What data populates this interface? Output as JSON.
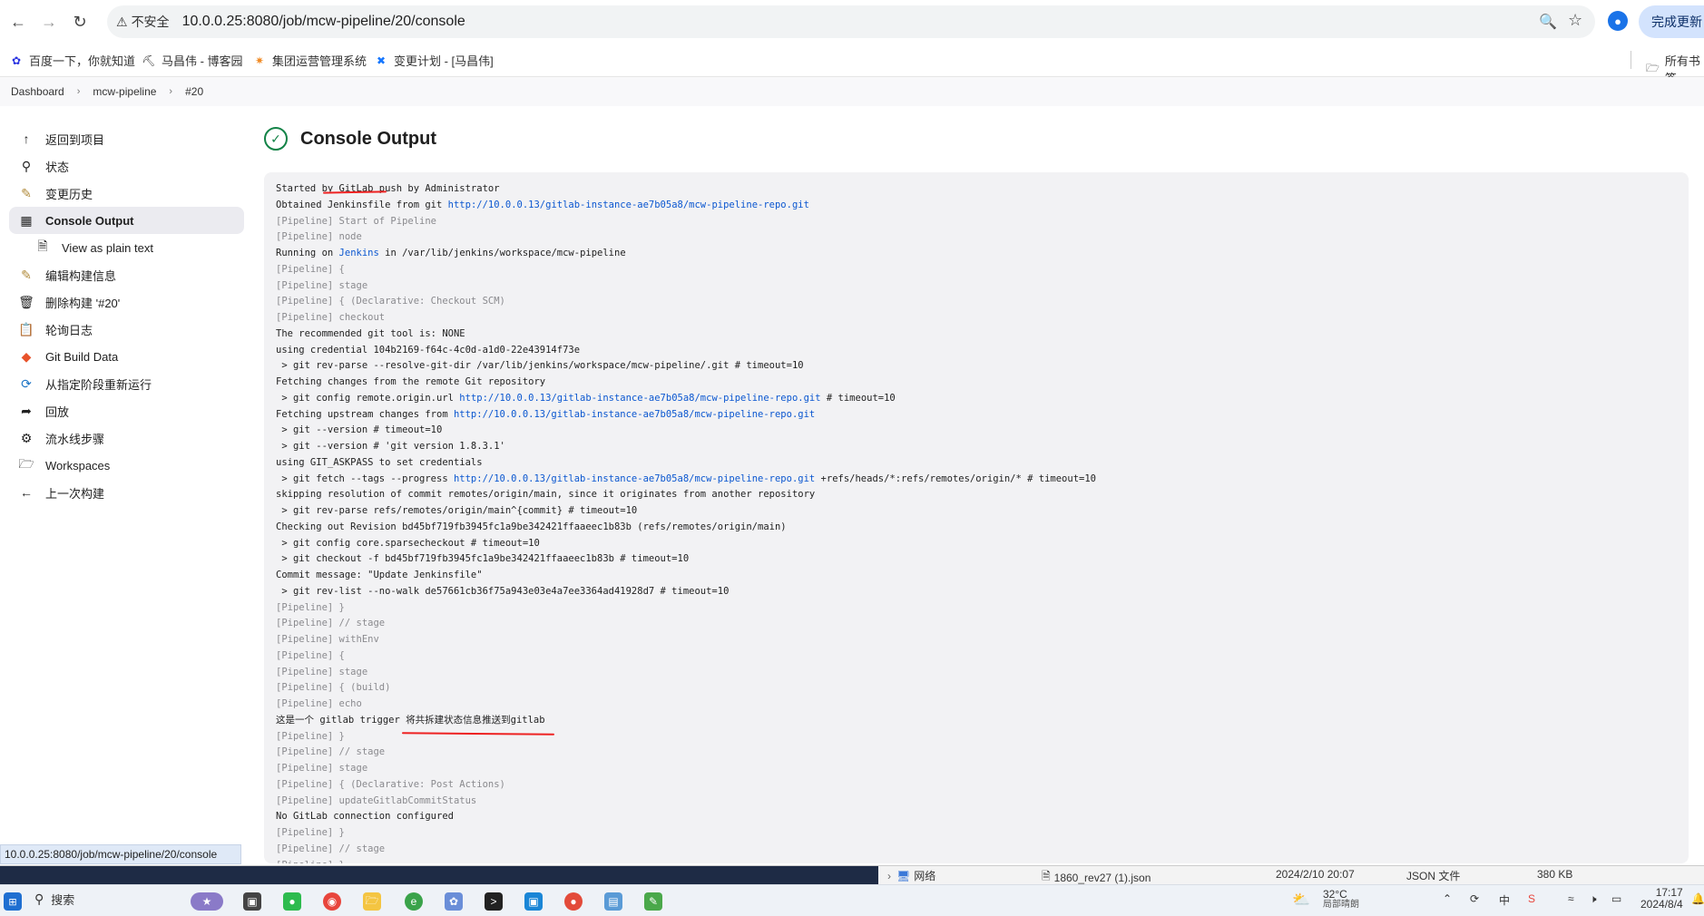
{
  "browser": {
    "security_label": "不安全",
    "url": "10.0.0.25:8080/job/mcw-pipeline/20/console",
    "update_button": "完成更新",
    "all_bookmarks": "所有书签"
  },
  "bookmarks": [
    {
      "label": "百度一下，你就知道",
      "icon": "baidu-paw-icon",
      "color": "#2932e1"
    },
    {
      "label": "马昌伟 - 博客园",
      "icon": "blog-icon",
      "color": "#333333"
    },
    {
      "label": "集团运营管理系统",
      "icon": "ops-system-icon",
      "color": "#f08a24"
    },
    {
      "label": "变更计划 - [马昌伟]",
      "icon": "change-plan-icon",
      "color": "#1677ff"
    }
  ],
  "breadcrumbs": [
    "Dashboard",
    "mcw-pipeline",
    "#20"
  ],
  "sidebar": {
    "items": [
      {
        "label": "返回到项目",
        "icon": "arrow-up-icon"
      },
      {
        "label": "状态",
        "icon": "search-icon"
      },
      {
        "label": "变更历史",
        "icon": "notepad-icon"
      },
      {
        "label": "Console Output",
        "icon": "terminal-icon"
      },
      {
        "label": "View as plain text",
        "icon": "document-icon"
      },
      {
        "label": "编辑构建信息",
        "icon": "notepad-edit-icon"
      },
      {
        "label": "删除构建 '#20'",
        "icon": "trash-icon"
      },
      {
        "label": "轮询日志",
        "icon": "clipboard-icon"
      },
      {
        "label": "Git Build Data",
        "icon": "git-icon"
      },
      {
        "label": "从指定阶段重新运行",
        "icon": "rerun-icon"
      },
      {
        "label": "回放",
        "icon": "replay-icon"
      },
      {
        "label": "流水线步骤",
        "icon": "gear-icon"
      },
      {
        "label": "Workspaces",
        "icon": "folder-icon"
      },
      {
        "label": "上一次构建",
        "icon": "arrow-left-icon"
      }
    ]
  },
  "page": {
    "title": "Console Output"
  },
  "console_lines": [
    {
      "t": "Started by GitLab push by Administrator",
      "k": "n"
    },
    {
      "t": "Obtained Jenkinsfile from git ",
      "link": "http://10.0.0.13/gitlab-instance-ae7b05a8/mcw-pipeline-repo.git",
      "after": "",
      "k": "n"
    },
    {
      "t": "[Pipeline] Start of Pipeline",
      "k": "p"
    },
    {
      "t": "[Pipeline] node",
      "k": "p"
    },
    {
      "t": "Running on ",
      "link": "Jenkins",
      "after": " in /var/lib/jenkins/workspace/mcw-pipeline",
      "k": "n"
    },
    {
      "t": "[Pipeline] {",
      "k": "p"
    },
    {
      "t": "[Pipeline] stage",
      "k": "p"
    },
    {
      "t": "[Pipeline] { (Declarative: Checkout SCM)",
      "k": "p"
    },
    {
      "t": "[Pipeline] checkout",
      "k": "p"
    },
    {
      "t": "The recommended git tool is: NONE",
      "k": "n"
    },
    {
      "t": "using credential 104b2169-f64c-4c0d-a1d0-22e43914f73e",
      "k": "n"
    },
    {
      "t": " > git rev-parse --resolve-git-dir /var/lib/jenkins/workspace/mcw-pipeline/.git # timeout=10",
      "k": "n"
    },
    {
      "t": "Fetching changes from the remote Git repository",
      "k": "n"
    },
    {
      "t": " > git config remote.origin.url ",
      "link": "http://10.0.0.13/gitlab-instance-ae7b05a8/mcw-pipeline-repo.git",
      "after": " # timeout=10",
      "k": "n"
    },
    {
      "t": "Fetching upstream changes from ",
      "link": "http://10.0.0.13/gitlab-instance-ae7b05a8/mcw-pipeline-repo.git",
      "after": "",
      "k": "n"
    },
    {
      "t": " > git --version # timeout=10",
      "k": "n"
    },
    {
      "t": " > git --version # 'git version 1.8.3.1'",
      "k": "n"
    },
    {
      "t": "using GIT_ASKPASS to set credentials",
      "k": "n"
    },
    {
      "t": " > git fetch --tags --progress ",
      "link": "http://10.0.0.13/gitlab-instance-ae7b05a8/mcw-pipeline-repo.git",
      "after": " +refs/heads/*:refs/remotes/origin/* # timeout=10",
      "k": "n"
    },
    {
      "t": "skipping resolution of commit remotes/origin/main, since it originates from another repository",
      "k": "n"
    },
    {
      "t": " > git rev-parse refs/remotes/origin/main^{commit} # timeout=10",
      "k": "n"
    },
    {
      "t": "Checking out Revision bd45bf719fb3945fc1a9be342421ffaaeec1b83b (refs/remotes/origin/main)",
      "k": "n"
    },
    {
      "t": " > git config core.sparsecheckout # timeout=10",
      "k": "n"
    },
    {
      "t": " > git checkout -f bd45bf719fb3945fc1a9be342421ffaaeec1b83b # timeout=10",
      "k": "n"
    },
    {
      "t": "Commit message: \"Update Jenkinsfile\"",
      "k": "n"
    },
    {
      "t": " > git rev-list --no-walk de57661cb36f75a943e03e4a7ee3364ad41928d7 # timeout=10",
      "k": "n"
    },
    {
      "t": "[Pipeline] }",
      "k": "p"
    },
    {
      "t": "[Pipeline] // stage",
      "k": "p"
    },
    {
      "t": "[Pipeline] withEnv",
      "k": "p"
    },
    {
      "t": "[Pipeline] {",
      "k": "p"
    },
    {
      "t": "[Pipeline] stage",
      "k": "p"
    },
    {
      "t": "[Pipeline] { (build)",
      "k": "p"
    },
    {
      "t": "[Pipeline] echo",
      "k": "p"
    },
    {
      "t": "这是一个 gitlab trigger 将共拆建状态信息推送到gitlab",
      "k": "n"
    },
    {
      "t": "[Pipeline] }",
      "k": "p"
    },
    {
      "t": "[Pipeline] // stage",
      "k": "p"
    },
    {
      "t": "[Pipeline] stage",
      "k": "p"
    },
    {
      "t": "[Pipeline] { (Declarative: Post Actions)",
      "k": "p"
    },
    {
      "t": "[Pipeline] updateGitlabCommitStatus",
      "k": "p"
    },
    {
      "t": "No GitLab connection configured",
      "k": "n"
    },
    {
      "t": "[Pipeline] }",
      "k": "p"
    },
    {
      "t": "[Pipeline] // stage",
      "k": "p"
    },
    {
      "t": "[Pipeline] }",
      "k": "p"
    }
  ],
  "status_bubble": "10.0.0.25:8080/job/mcw-pipeline/20/console",
  "explorer": {
    "folder": "网络",
    "file_name": "1860_rev27 (1).json",
    "file_date": "2024/2/10 20:07",
    "file_type": "JSON 文件",
    "file_size": "380 KB"
  },
  "taskbar": {
    "search_label": "搜索",
    "weather_temp": "32°C",
    "weather_text": "局部晴朗",
    "ime": "中",
    "time": "17:17",
    "date": "2024/8/4"
  }
}
